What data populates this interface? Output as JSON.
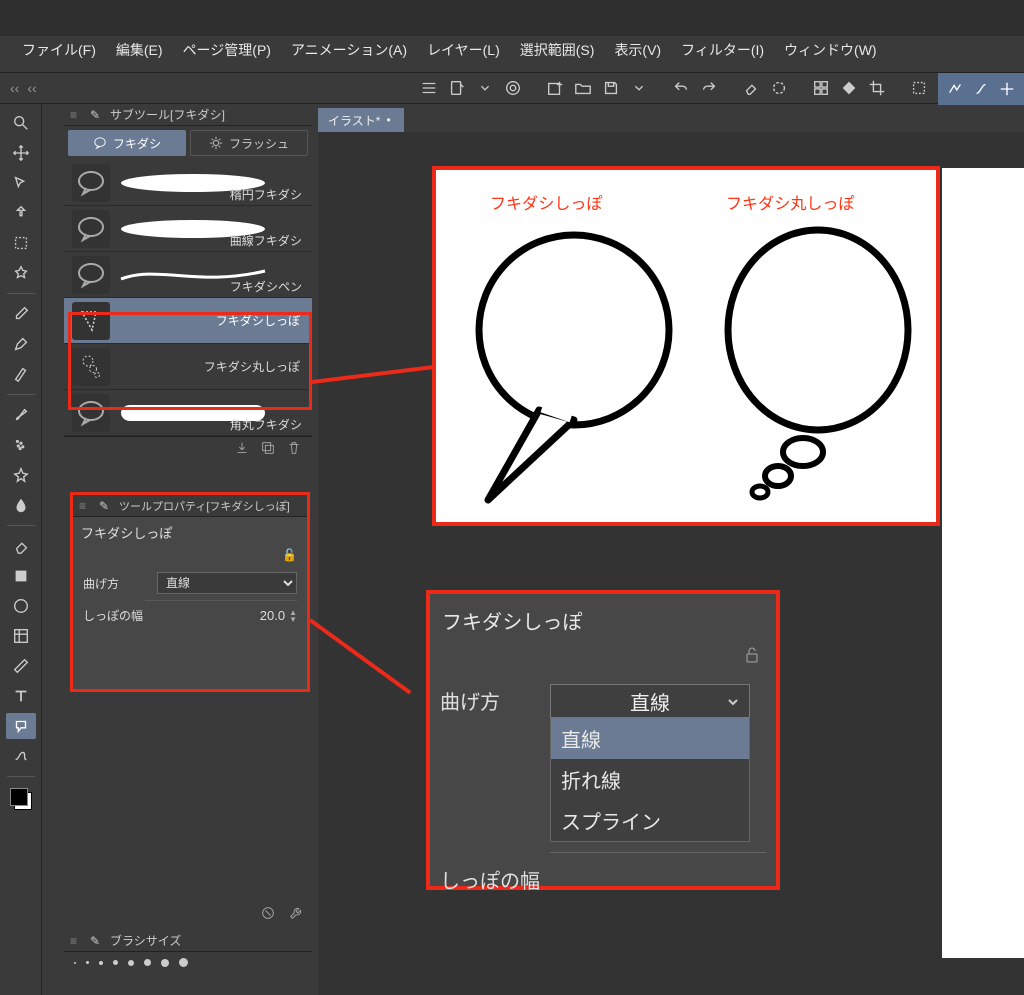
{
  "menubar": [
    "ファイル(F)",
    "編集(E)",
    "ページ管理(P)",
    "アニメーション(A)",
    "レイヤー(L)",
    "選択範囲(S)",
    "表示(V)",
    "フィルター(I)",
    "ウィンドウ(W)"
  ],
  "canvas": {
    "tab_label": "イラスト*"
  },
  "subtool": {
    "panel_title": "サブツール[フキダシ]",
    "tabs": {
      "balloon": "フキダシ",
      "flash": "フラッシュ"
    },
    "items": [
      {
        "label": "楕円フキダシ"
      },
      {
        "label": "曲線フキダシ"
      },
      {
        "label": "フキダシペン"
      },
      {
        "label": "フキダシしっぽ"
      },
      {
        "label": "フキダシ丸しっぽ"
      },
      {
        "label": "角丸フキダシ"
      }
    ]
  },
  "toolprop": {
    "panel_title": "ツールプロパティ[フキダシしっぽ]",
    "name": "フキダシしっぽ",
    "bend_label": "曲げ方",
    "bend_value": "直線",
    "tailwidth_label": "しっぽの幅",
    "tailwidth_value": "20.0"
  },
  "tp_popup": {
    "title": "フキダシしっぽ",
    "bend_label": "曲げ方",
    "bend_value": "直線",
    "options": [
      "直線",
      "折れ線",
      "スプライン"
    ],
    "tailwidth_label": "しっぽの幅"
  },
  "brush_panel_title": "ブラシサイズ",
  "sample": {
    "caption1": "フキダシしっぽ",
    "caption2": "フキダシ丸しっぽ"
  }
}
